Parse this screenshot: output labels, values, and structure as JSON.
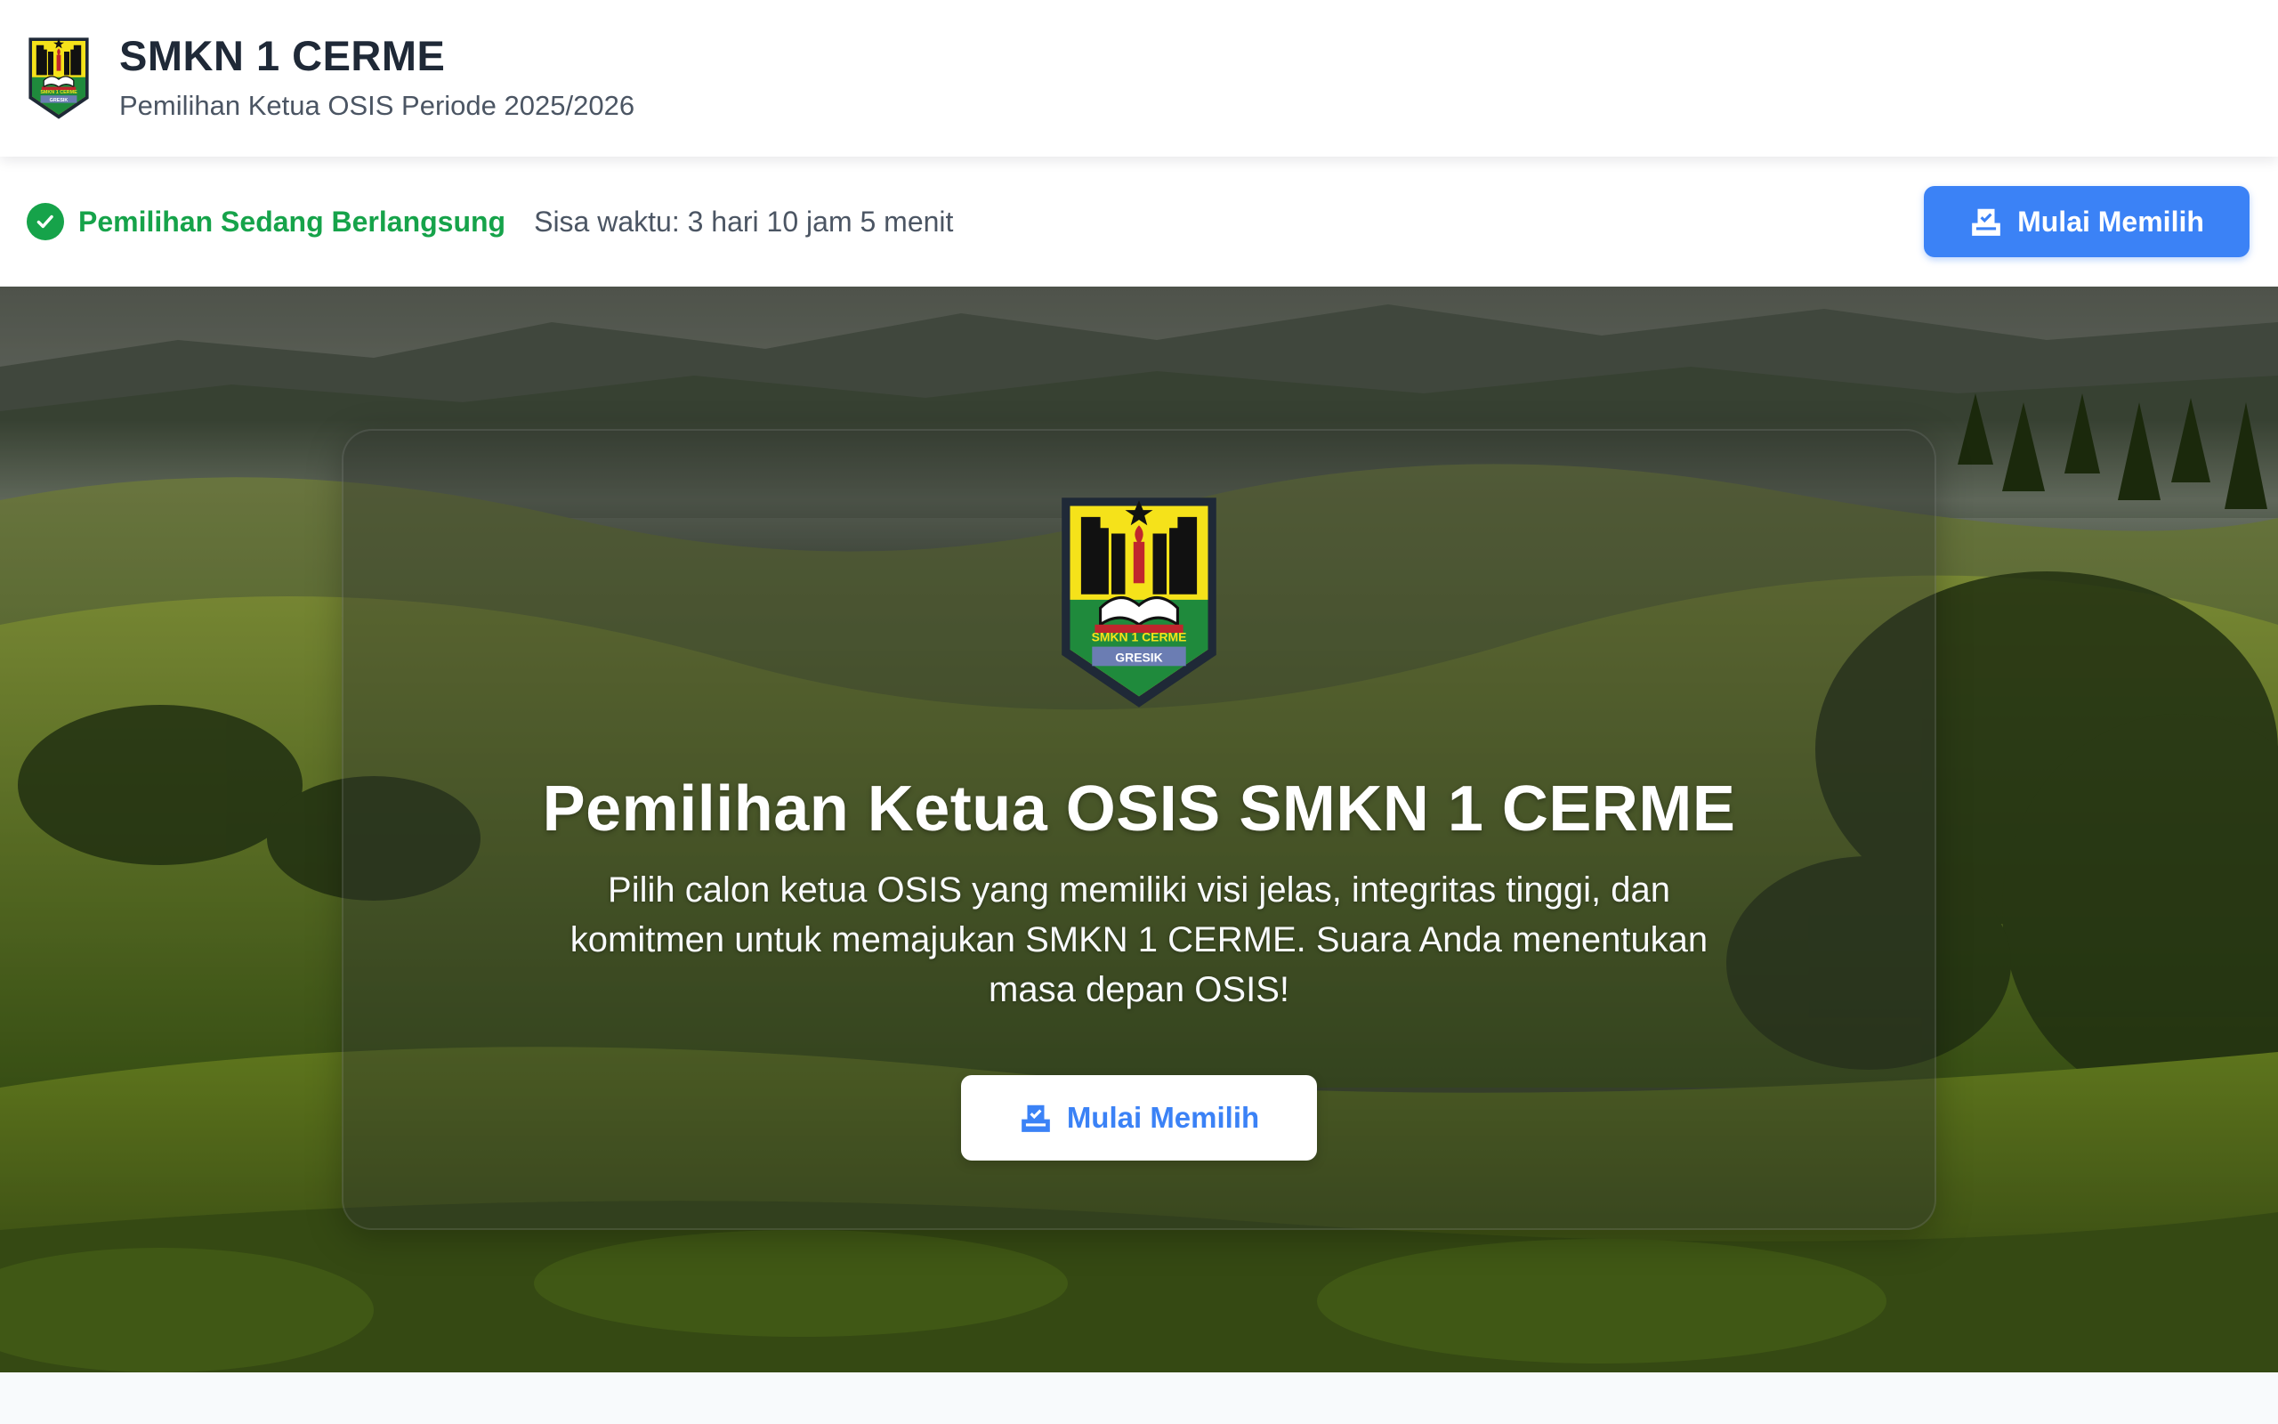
{
  "header": {
    "logo_icon": "school-crest-icon",
    "logo_text": "SMKN 1 CERME",
    "logo_region": "GRESIK",
    "title": "SMKN 1 CERME",
    "subtitle": "Pemilihan Ketua OSIS Periode 2025/2026"
  },
  "status": {
    "icon": "check-circle-icon",
    "label": "Pemilihan Sedang Berlangsung",
    "time_remaining": "Sisa waktu: 3 hari 10 jam 5 menit",
    "color": "#16a34a"
  },
  "actions": {
    "vote_icon": "ballot-box-icon",
    "vote_label": "Mulai Memilih"
  },
  "hero": {
    "logo_icon": "school-crest-icon",
    "logo_text": "SMKN 1 CERME",
    "logo_region": "GRESIK",
    "title": "Pemilihan Ketua OSIS SMKN 1 CERME",
    "description": "Pilih calon ketua OSIS yang memiliki visi jelas, integritas tinggi, dan komitmen untuk memajukan SMKN 1 CERME. Suara Anda menentukan masa depan OSIS!",
    "button_icon": "ballot-box-icon",
    "button_label": "Mulai Memilih",
    "background": "hills-landscape-photo"
  },
  "colors": {
    "accent": "#3b82f6",
    "success": "#16a34a",
    "title_text": "#1f2937",
    "muted_text": "#4b5563"
  }
}
